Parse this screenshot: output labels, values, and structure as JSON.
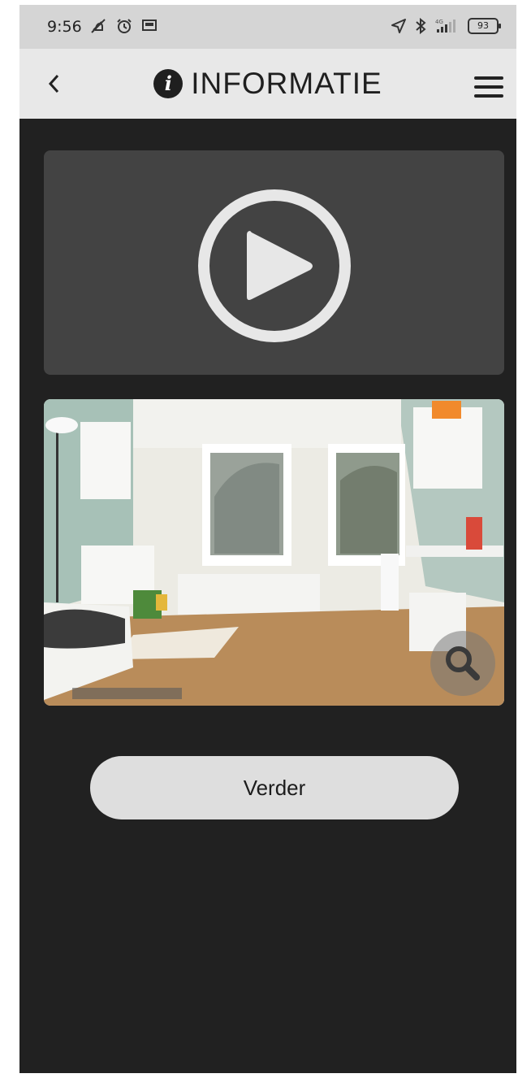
{
  "status_bar": {
    "time": "9:56",
    "battery_level": "93",
    "network": "4G",
    "left_icons": [
      "notification-off-icon",
      "alarm-icon",
      "screen-cast-icon"
    ],
    "right_icons": [
      "location-arrow-icon",
      "bluetooth-icon",
      "signal-icon",
      "battery-icon"
    ]
  },
  "header": {
    "back_icon": "chevron-left-icon",
    "title_icon": "info-circle-icon",
    "title": "INFORMATIE",
    "menu_icon": "hamburger-menu-icon"
  },
  "video": {
    "icon": "play-circle-icon"
  },
  "photo": {
    "subject": "bedroom-photo",
    "zoom_icon": "magnifier-icon"
  },
  "actions": {
    "next_label": "Verder"
  },
  "colors": {
    "status_bar_bg": "#d5d5d5",
    "header_bg": "#e8e8e8",
    "page_bg": "#212121",
    "video_panel_bg": "#434343",
    "button_bg": "#dedede"
  }
}
